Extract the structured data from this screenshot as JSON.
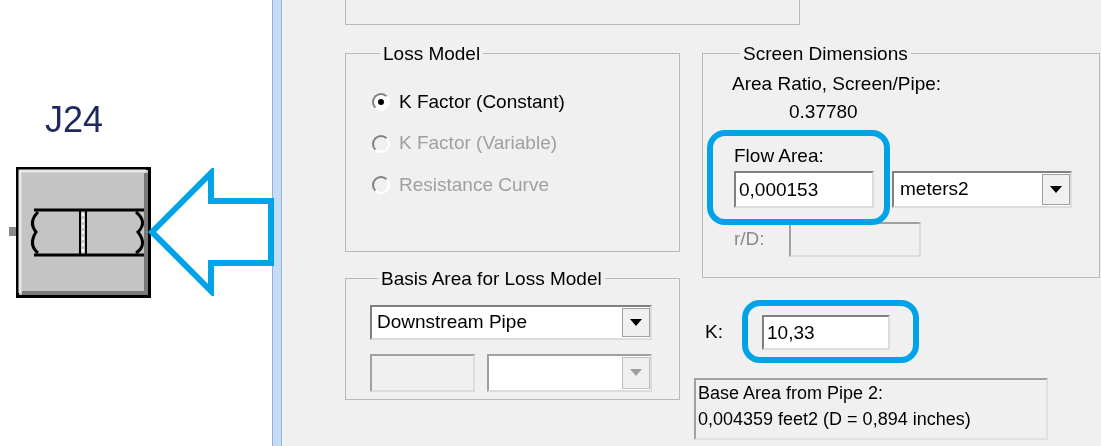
{
  "diagram": {
    "junction_label": "J24"
  },
  "loss_model": {
    "title": "Loss Model",
    "options": [
      {
        "label": "K Factor (Constant)",
        "selected": true,
        "disabled": false
      },
      {
        "label": "K Factor (Variable)",
        "selected": false,
        "disabled": true
      },
      {
        "label": "Resistance Curve",
        "selected": false,
        "disabled": true
      }
    ]
  },
  "basis_area": {
    "title": "Basis Area for Loss Model",
    "dropdown_value": "Downstream Pipe"
  },
  "screen_dimensions": {
    "title": "Screen Dimensions",
    "area_ratio_label": "Area Ratio, Screen/Pipe:",
    "area_ratio_value": "0.37780",
    "flow_area": {
      "label": "Flow Area:",
      "value": "0,000153",
      "unit": "meters2",
      "highlighted": true
    },
    "r_d": {
      "label": "r/D:",
      "disabled": true
    }
  },
  "k": {
    "label": "K:",
    "value": "10,33",
    "highlighted": true
  },
  "base_area_info": [
    "Base Area from Pipe 2:",
    "0,004359 feet2 (D = 0,894 inches)"
  ]
}
